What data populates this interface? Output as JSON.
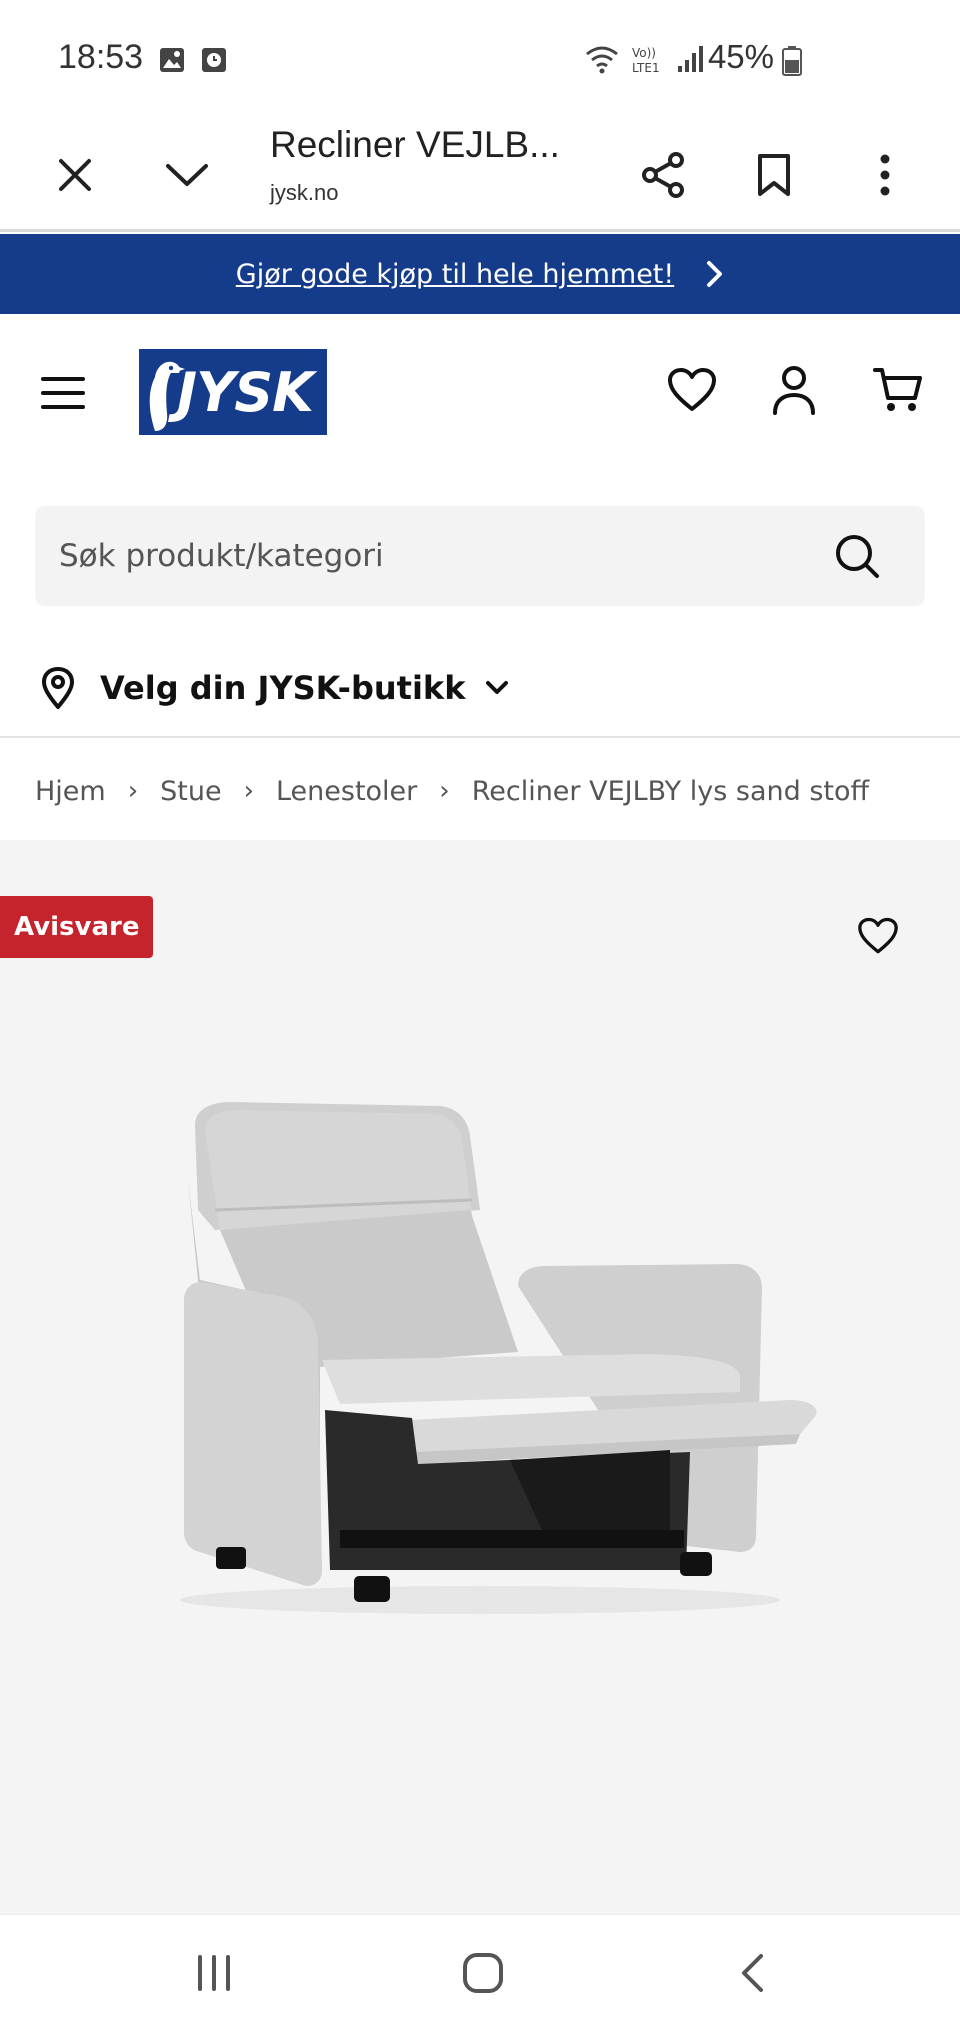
{
  "status_bar": {
    "time": "18:53",
    "battery": "45%"
  },
  "browser": {
    "title": "Recliner VEJLB...",
    "url": "jysk.no"
  },
  "promo": {
    "text": "Gjør gode kjøp til hele hjemmet!"
  },
  "header": {
    "logo_text": "JYSK"
  },
  "search": {
    "placeholder": "Søk produkt/kategori"
  },
  "store": {
    "label": "Velg din JYSK-butikk"
  },
  "breadcrumb": {
    "items": [
      "Hjem",
      "Stue",
      "Lenestoler",
      "Recliner VEJLBY lys sand stoff"
    ],
    "separator": "›"
  },
  "product": {
    "badge": "Avisvare"
  },
  "colors": {
    "brand_blue": "#143c8a",
    "badge_red": "#c5242c",
    "product_bg": "#f4f4f4"
  }
}
